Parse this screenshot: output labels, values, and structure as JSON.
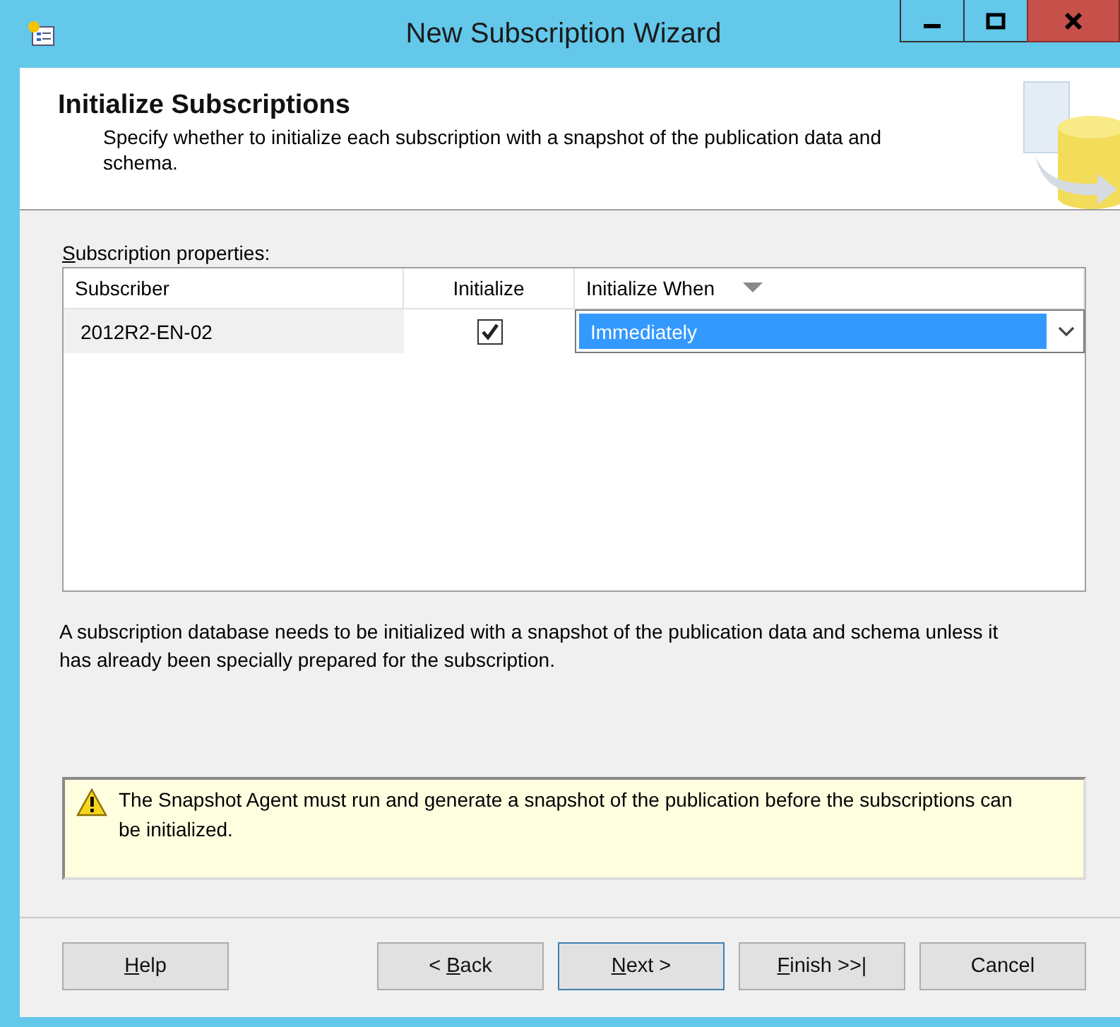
{
  "window": {
    "title": "New Subscription Wizard"
  },
  "header": {
    "title": "Initialize Subscriptions",
    "description": "Specify whether to initialize each subscription with a snapshot of the publication data and schema."
  },
  "grid": {
    "label": {
      "key": "S",
      "after": "ubscription properties:"
    },
    "columns": [
      {
        "label": "Subscriber",
        "kind": "text"
      },
      {
        "label": "Initialize",
        "kind": "check"
      },
      {
        "label": "Initialize When",
        "kind": "combo"
      }
    ],
    "rows": [
      {
        "subscriber": "2012R2-EN-02",
        "initialize": true,
        "initialize_when": "Immediately"
      }
    ]
  },
  "description": "A subscription database needs to be initialized with a snapshot of the publication data and schema unless it has already been specially prepared for the subscription.",
  "warning": "The Snapshot Agent must run and generate a snapshot of the publication before the subscriptions can be initialized.",
  "buttons": [
    {
      "key": "H",
      "after": "elp",
      "default": false
    },
    {
      "before": "< ",
      "key": "B",
      "after": "ack",
      "default": false
    },
    {
      "key": "N",
      "after": "ext >",
      "default": true
    },
    {
      "key": "F",
      "after": "inish >>|",
      "default": false
    },
    {
      "before": "Cancel",
      "default": false
    }
  ]
}
